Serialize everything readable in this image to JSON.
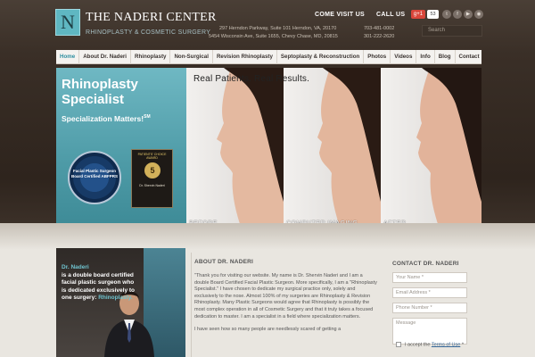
{
  "header": {
    "logo_letter": "N",
    "brand": "THE NADERI CENTER",
    "tagline": "RHINOPLASTY & COSMETIC SURGERY",
    "come_visit_label": "COME VISIT US",
    "call_us_label": "CALL US",
    "addresses": [
      "297 Herndon Parkway, Suite 101 Herndon, VA, 20170",
      "5454 Wisconsin Ave, Suite 1655, Chevy Chase, MD, 20815"
    ],
    "phones": [
      "703-481-0002",
      "301-222-2620"
    ],
    "gplus_label": "g+1",
    "gplus_count": "53",
    "social_icons": [
      "twitter-icon",
      "facebook-icon",
      "youtube-icon",
      "rss-icon"
    ],
    "search_placeholder": "Search"
  },
  "nav": {
    "items": [
      "Home",
      "About Dr. Naderi",
      "Rhinoplasty",
      "Non-Surgical",
      "Revision Rhinoplasty",
      "Septoplasty & Reconstruction",
      "Photos",
      "Videos",
      "Info",
      "Blog",
      "Contact"
    ],
    "active": "Home"
  },
  "banner": {
    "title": "Rhinoplasty Specialist",
    "subtitle": "Specialization Matters!",
    "subtitle_mark": "SM",
    "seal_text": "Facial Plastic Surgeon Board Certified ABFPRS",
    "award_top": "PATIENTS' CHOICE AWARD",
    "award_number": "5",
    "award_name": "Dr. Shervin Naderi",
    "headline": "Real Patients. Real Results.",
    "panels": [
      "BEFORE",
      "COMPUTER IMAGING",
      "AFTER"
    ]
  },
  "doctor_box": {
    "name": "Dr. Naderi",
    "line": "is a double board certified facial plastic surgeon who is dedicated exclusively to one surgery:",
    "emphasis": "Rhinoplasty."
  },
  "about": {
    "heading": "ABOUT DR. NADERI",
    "paragraphs": [
      "\"Thank you for visiting our website. My name is Dr. Shervin Naderi and I am a double Board Certified Facial Plastic Surgeon. More specifically, I am a \"Rhinoplasty Specialist.\" I have chosen to dedicate my surgical practice only, solely and exclusively to the nose. Almost 100% of my surgeries are Rhinoplasty & Revision Rhinoplasty. Many Plastic Surgeons would agree that Rhinoplasty is possibly the most complex operation in all of Cosmetic Surgery and that it truly takes a focused dedication to master. I am a specialist in a field where specialization matters.",
      "I have seen how so many people are needlessly scared of getting a"
    ]
  },
  "contact": {
    "heading": "CONTACT DR. NADERI",
    "fields": [
      "Your Name *",
      "Email Address *",
      "Phone Number *",
      "Message"
    ],
    "accept_text": "I accept the",
    "terms_link": "Terms of Use",
    "accept_suffix": "*"
  }
}
